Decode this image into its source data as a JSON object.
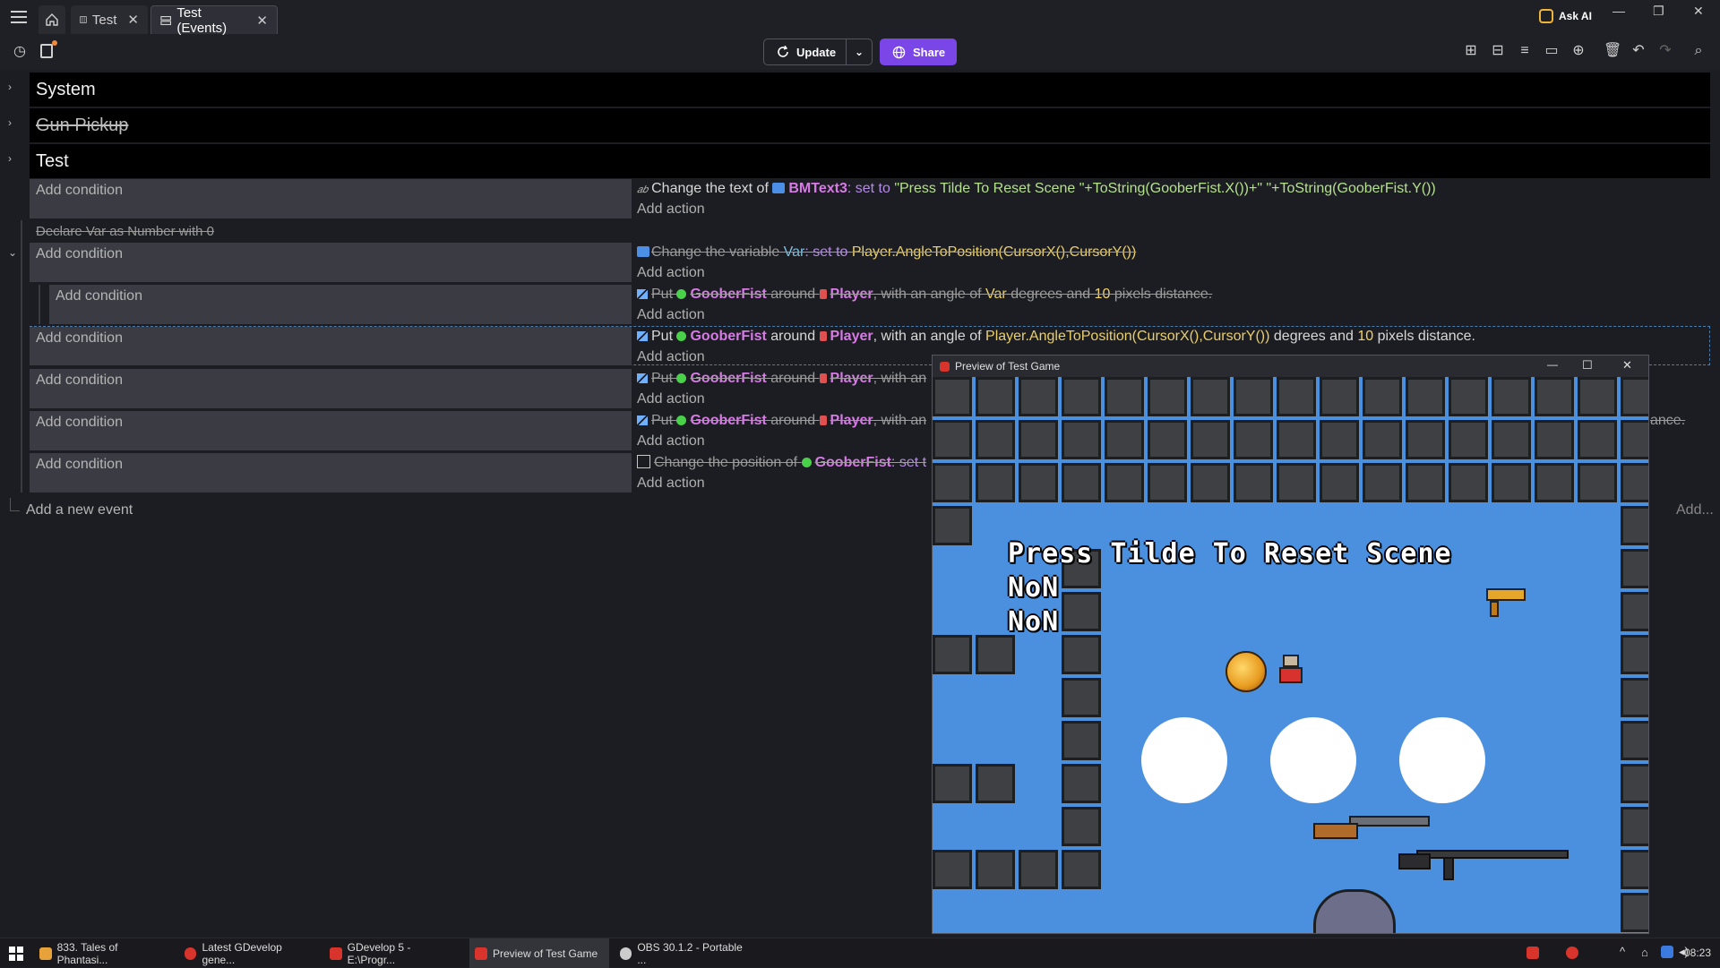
{
  "tabs": [
    {
      "label": "Test"
    },
    {
      "label": "Test (Events)"
    }
  ],
  "window": {
    "ask_ai": "Ask AI"
  },
  "toolbar": {
    "update_label": "Update",
    "share_label": "Share"
  },
  "groups": [
    {
      "label": "System"
    },
    {
      "label": "Gun Pickup"
    },
    {
      "label": "Test"
    }
  ],
  "labels": {
    "add_condition": "Add condition",
    "add_action": "Add action",
    "add_new_event": "Add a new event",
    "add_more": "Add..."
  },
  "events": {
    "text_action": {
      "prefix": "Change the text of",
      "object": "BMText3",
      "kw": ": set to",
      "value": "\"Press Tilde To Reset Scene \"+ToString(GooberFist.X())+\" \"+ToString(GooberFist.Y())"
    },
    "declare": "Declare  Var as  Number with 0",
    "var_action": {
      "prefix": "Change the variable",
      "var": "Var",
      "kw": ": set to",
      "value": "Player.AngleToPosition(CursorX(),CursorY())"
    },
    "put_var": {
      "put": "Put",
      "obj": "GooberFist",
      "around": "around",
      "target": "Player",
      "angle": ", with an angle of",
      "angle_value": "Var",
      "degrees": "degrees and",
      "dist": "10",
      "tail": "pixels distance."
    },
    "put_expr": {
      "put": "Put",
      "obj": "GooberFist",
      "around": "around",
      "target": "Player",
      "angle": ", with an angle of",
      "angle_value": "Player.AngleToPosition(CursorX(),CursorY())",
      "degrees": "degrees and",
      "dist": "10",
      "tail": "pixels distance."
    },
    "put_trunc": {
      "put": "Put",
      "obj": "GooberFist",
      "around": "around",
      "target": "Player",
      "angle": ", with an"
    },
    "put_trunc2_tail": "ance.",
    "pos_action": {
      "prefix": "Change the position of",
      "obj": "GooberFist",
      "kw": ": set t"
    }
  },
  "preview": {
    "title": "Preview of Test Game",
    "game_text": [
      "Press Tilde To Reset Scene",
      "NoN",
      "NoN"
    ]
  },
  "taskbar": [
    {
      "label": "833. Tales of Phantasi...",
      "color": "#e8a23a"
    },
    {
      "label": "Latest GDevelop gene...",
      "color": "#d9342b"
    },
    {
      "label": "GDevelop 5 - E:\\Progr...",
      "color": "#d9342b"
    },
    {
      "label": "Preview of Test Game",
      "color": "#d9342b"
    },
    {
      "label": "OBS 30.1.2 - Portable ...",
      "color": "#cccccc"
    }
  ],
  "clock": "08:23",
  "colors": {
    "accent": "#7b46e8",
    "game_sky": "#4a90df"
  }
}
